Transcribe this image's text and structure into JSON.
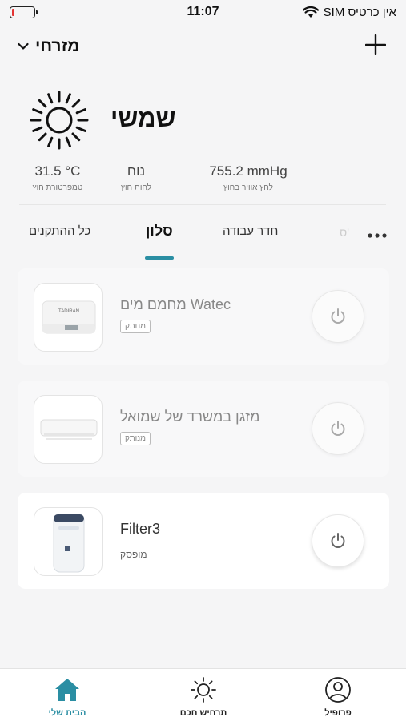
{
  "status_bar": {
    "time": "11:07",
    "carrier": "אין כרטיס SIM",
    "battery_level": 0.12,
    "battery_color": "#e33333"
  },
  "header": {
    "home_name": "מזרחי",
    "add_icon": "plus-icon",
    "chevron_icon": "chevron-down-icon"
  },
  "weather": {
    "condition": "שמשי",
    "icon": "sun-icon",
    "stats": [
      {
        "value": "31.5 °C",
        "label": "טמפרטורת חוץ"
      },
      {
        "value": "נוח",
        "label": "לחות חוץ"
      },
      {
        "value": "755.2 mmHg",
        "label": "לחץ אוויר בחוץ"
      }
    ]
  },
  "tabs": {
    "all_devices": "כל ההתקנים",
    "living_room": "סלון",
    "study": "חדר עבודה",
    "partial": "ס'",
    "more_icon": "more-horizontal-icon"
  },
  "devices": [
    {
      "name": "מחמם מים Watec",
      "status": "מנותק",
      "offline": true,
      "thumb_brand": "TADIRAN"
    },
    {
      "name": "מזגן במשרד של שמואל",
      "status": "מנותק",
      "offline": true
    },
    {
      "name": "Filter3",
      "status": "מופסק",
      "offline": false
    }
  ],
  "bottom_nav": {
    "home": "הבית שלי",
    "scenes": "תרחיש חכם",
    "profile": "פרופיל",
    "accent_color": "#2a8ea3"
  }
}
